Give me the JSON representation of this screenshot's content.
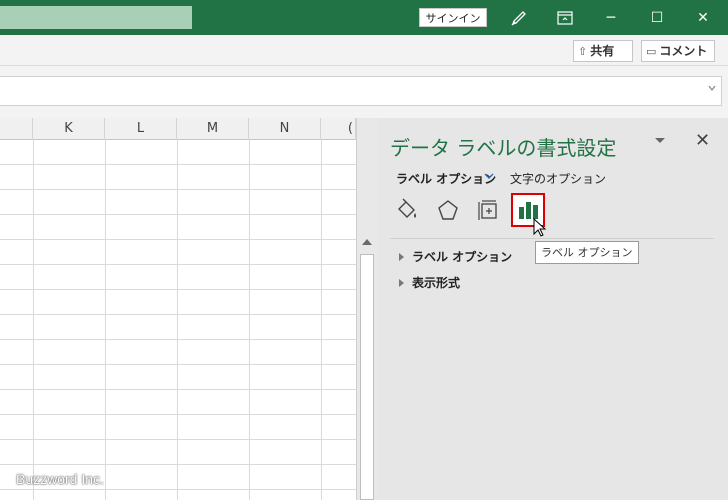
{
  "titlebar": {
    "signin_label": "サインイン",
    "icons": [
      "pen-icon",
      "ribbon-display-icon",
      "minimize-icon",
      "maximize-icon",
      "close-icon"
    ],
    "minimize": "─",
    "maximize": "☐",
    "close": "✕"
  },
  "ribbon": {
    "share_icon": "⇧",
    "share_label": "共有",
    "comment_icon": "▭",
    "comment_label": "コメント"
  },
  "grid": {
    "columns": [
      "K",
      "L",
      "M",
      "N",
      "("
    ]
  },
  "pane": {
    "title": "データ ラベルの書式設定",
    "close": "✕",
    "tabs": [
      {
        "label": "ラベル オプション",
        "active": true
      },
      {
        "label": "文字のオプション",
        "active": false
      }
    ],
    "tab_chevron": "⌄",
    "icons": [
      "fill-line-icon",
      "effects-icon",
      "size-properties-icon",
      "label-options-icon"
    ],
    "sections": [
      {
        "label": "ラベル オプション"
      },
      {
        "label": "表示形式"
      }
    ],
    "tooltip": "ラベル オプション"
  },
  "watermark": "Buzzword Inc.",
  "colors": {
    "brand_green": "#217346",
    "selected_border": "#d00000",
    "bar_green": "#217346"
  }
}
